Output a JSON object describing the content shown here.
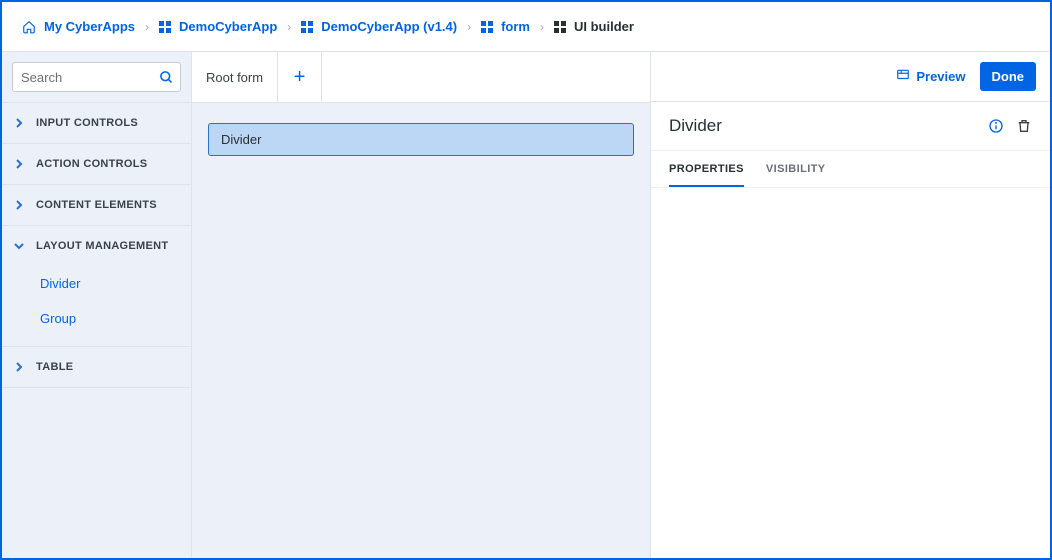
{
  "breadcrumb": {
    "items": [
      {
        "label": "My CyberApps",
        "current": false
      },
      {
        "label": "DemoCyberApp",
        "current": false
      },
      {
        "label": "DemoCyberApp (v1.4)",
        "current": false
      },
      {
        "label": "form",
        "current": false
      },
      {
        "label": "UI builder",
        "current": true
      }
    ]
  },
  "sidebar": {
    "search_placeholder": "Search",
    "categories": [
      {
        "label": "INPUT CONTROLS",
        "expanded": false
      },
      {
        "label": "ACTION CONTROLS",
        "expanded": false
      },
      {
        "label": "CONTENT ELEMENTS",
        "expanded": false
      },
      {
        "label": "LAYOUT MANAGEMENT",
        "expanded": true,
        "items": [
          {
            "label": "Divider"
          },
          {
            "label": "Group"
          }
        ]
      },
      {
        "label": "TABLE",
        "expanded": false
      }
    ]
  },
  "canvas": {
    "tab_label": "Root form",
    "element_label": "Divider"
  },
  "rpanel": {
    "preview_label": "Preview",
    "done_label": "Done",
    "title": "Divider",
    "tabs": [
      {
        "label": "PROPERTIES",
        "active": true
      },
      {
        "label": "VISIBILITY",
        "active": false
      }
    ]
  }
}
